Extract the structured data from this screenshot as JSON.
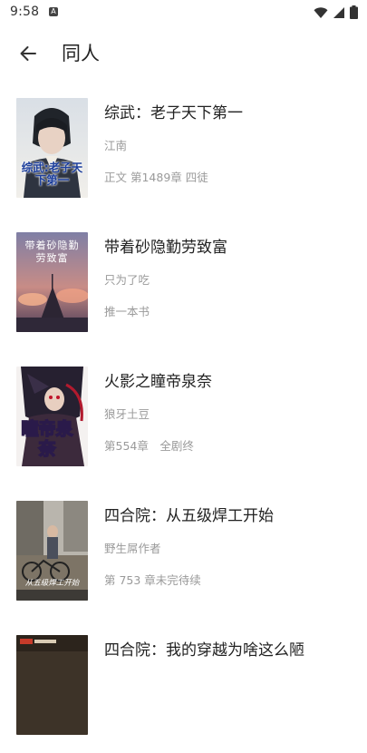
{
  "status_bar": {
    "time": "9:58",
    "notification_icon": "A"
  },
  "app_bar": {
    "title": "同人"
  },
  "books": [
    {
      "title": "综武：老子天下第一",
      "author": "江南",
      "status": "正文 第1489章 四徒",
      "cover_text": "综武:老子天下第一"
    },
    {
      "title": "带着砂隐勤劳致富",
      "author": "只为了吃",
      "status": "推一本书",
      "cover_text": "带着砂隐勤劳致富"
    },
    {
      "title": "火影之瞳帝泉奈",
      "author": "狼牙土豆",
      "status": "第554章　全剧终",
      "cover_text": "瞳帝泉奈"
    },
    {
      "title": "四合院：从五级焊工开始",
      "author": "野生屌作者",
      "status": "第 753 章未完待续",
      "cover_text": "从五级焊工开始"
    },
    {
      "title": "四合院：我的穿越为啥这么陋",
      "author": "",
      "status": "",
      "cover_text": ""
    }
  ],
  "colors": {
    "title": "#222222",
    "meta": "#9a9a9a",
    "background": "#ffffff"
  },
  "icons": {
    "back": "arrow-left-icon",
    "wifi": "wifi-icon",
    "signal": "signal-icon",
    "battery": "battery-icon"
  }
}
